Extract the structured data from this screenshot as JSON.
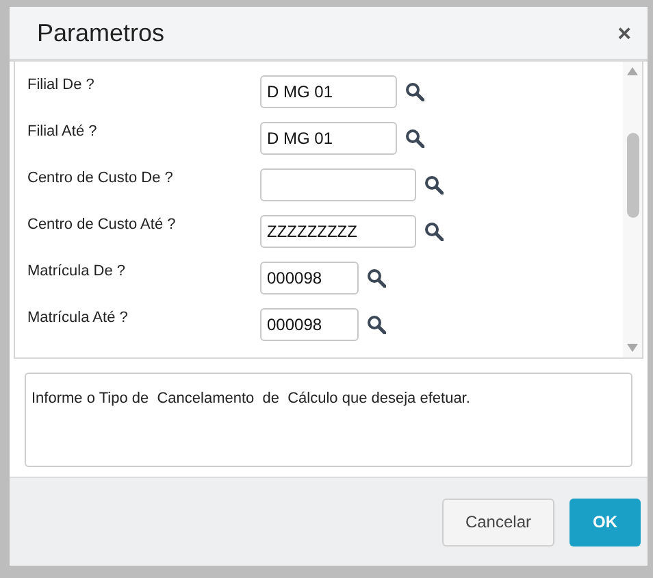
{
  "dialog": {
    "title": "Parametros",
    "close": "×"
  },
  "fields": [
    {
      "label": "Filial De ?",
      "value": "D MG 01",
      "kind": "medium"
    },
    {
      "label": "Filial Até ?",
      "value": "D MG 01",
      "kind": "medium"
    },
    {
      "label": "Centro de Custo De ?",
      "kind": "long"
    },
    {
      "label": "Centro de Custo Até ?",
      "value": "ZZZZZZZZZ",
      "kind": "long"
    },
    {
      "label": "Matrícula De ?",
      "value": "000098",
      "kind": "short"
    },
    {
      "label": "Matrícula Até ?",
      "value": "000098",
      "kind": "short"
    }
  ],
  "help_text": "Informe o Tipo de  Cancelamento  de  Cálculo que deseja efetuar.",
  "buttons": [
    {
      "label": "Cancelar",
      "kind": "secondary"
    },
    {
      "label": "OK",
      "kind": "primary"
    }
  ]
}
